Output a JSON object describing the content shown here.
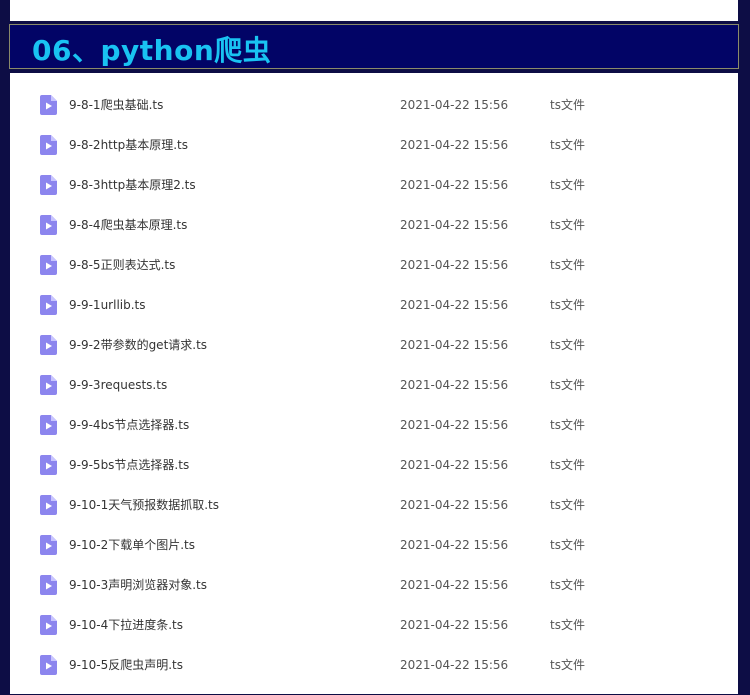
{
  "header": {
    "title": "06、python爬虫"
  },
  "colors": {
    "background": "#0d0d45",
    "header_bg": "#020466",
    "title": "#19c3f2",
    "icon": "#8c85ee"
  },
  "files": [
    {
      "name": "9-8-1爬虫基础.ts",
      "date": "2021-04-22 15:56",
      "type": "ts文件",
      "icon": "video-file-icon"
    },
    {
      "name": "9-8-2http基本原理.ts",
      "date": "2021-04-22 15:56",
      "type": "ts文件",
      "icon": "video-file-icon"
    },
    {
      "name": "9-8-3http基本原理2.ts",
      "date": "2021-04-22 15:56",
      "type": "ts文件",
      "icon": "video-file-icon"
    },
    {
      "name": "9-8-4爬虫基本原理.ts",
      "date": "2021-04-22 15:56",
      "type": "ts文件",
      "icon": "video-file-icon"
    },
    {
      "name": "9-8-5正则表达式.ts",
      "date": "2021-04-22 15:56",
      "type": "ts文件",
      "icon": "video-file-icon"
    },
    {
      "name": "9-9-1urllib.ts",
      "date": "2021-04-22 15:56",
      "type": "ts文件",
      "icon": "video-file-icon"
    },
    {
      "name": "9-9-2带参数的get请求.ts",
      "date": "2021-04-22 15:56",
      "type": "ts文件",
      "icon": "video-file-icon"
    },
    {
      "name": "9-9-3requests.ts",
      "date": "2021-04-22 15:56",
      "type": "ts文件",
      "icon": "video-file-icon"
    },
    {
      "name": "9-9-4bs节点选择器.ts",
      "date": "2021-04-22 15:56",
      "type": "ts文件",
      "icon": "video-file-icon"
    },
    {
      "name": "9-9-5bs节点选择器.ts",
      "date": "2021-04-22 15:56",
      "type": "ts文件",
      "icon": "video-file-icon"
    },
    {
      "name": "9-10-1天气预报数据抓取.ts",
      "date": "2021-04-22 15:56",
      "type": "ts文件",
      "icon": "video-file-icon"
    },
    {
      "name": "9-10-2下载单个图片.ts",
      "date": "2021-04-22 15:56",
      "type": "ts文件",
      "icon": "video-file-icon"
    },
    {
      "name": "9-10-3声明浏览器对象.ts",
      "date": "2021-04-22 15:56",
      "type": "ts文件",
      "icon": "video-file-icon"
    },
    {
      "name": "9-10-4下拉进度条.ts",
      "date": "2021-04-22 15:56",
      "type": "ts文件",
      "icon": "video-file-icon"
    },
    {
      "name": "9-10-5反爬虫声明.ts",
      "date": "2021-04-22 15:56",
      "type": "ts文件",
      "icon": "video-file-icon"
    }
  ]
}
